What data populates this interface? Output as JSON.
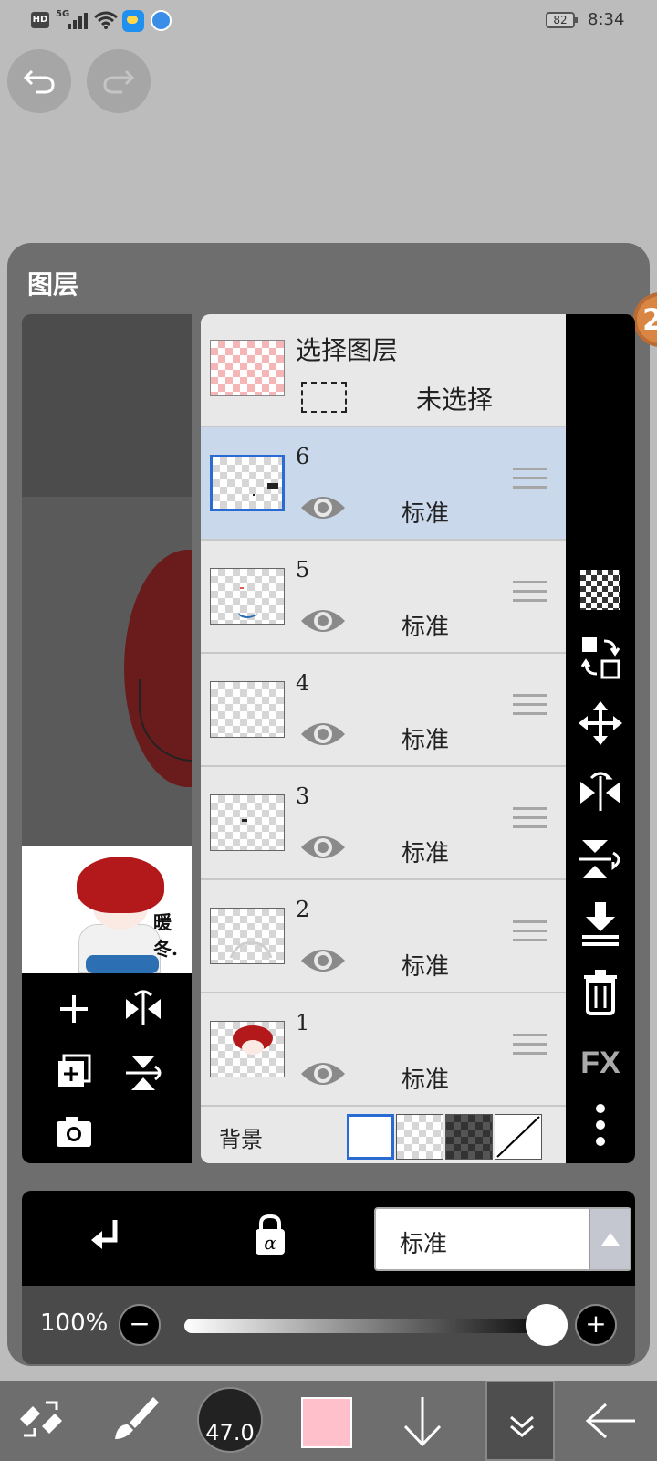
{
  "status_bar": {
    "hd": "HD",
    "network": "5G",
    "battery": "82",
    "time": "8:34"
  },
  "panel": {
    "title": "图层",
    "badge": "2"
  },
  "selection": {
    "title": "选择图层",
    "status": "未选择"
  },
  "layers": [
    {
      "number": "6",
      "mode": "标准",
      "active": true
    },
    {
      "number": "5",
      "mode": "标准",
      "active": false
    },
    {
      "number": "4",
      "mode": "标准",
      "active": false
    },
    {
      "number": "3",
      "mode": "标准",
      "active": false
    },
    {
      "number": "2",
      "mode": "标准",
      "active": false
    },
    {
      "number": "1",
      "mode": "标准",
      "active": false
    }
  ],
  "background": {
    "label": "背景"
  },
  "right_tools": {
    "fx_label": "FX"
  },
  "blend": {
    "mode": "标准"
  },
  "opacity": {
    "label": "100%",
    "value": 100
  },
  "bottom_bar": {
    "brush_size": "47.0",
    "color": "#ffc0cb"
  },
  "thumbnail": {
    "signature": "暖冬."
  }
}
